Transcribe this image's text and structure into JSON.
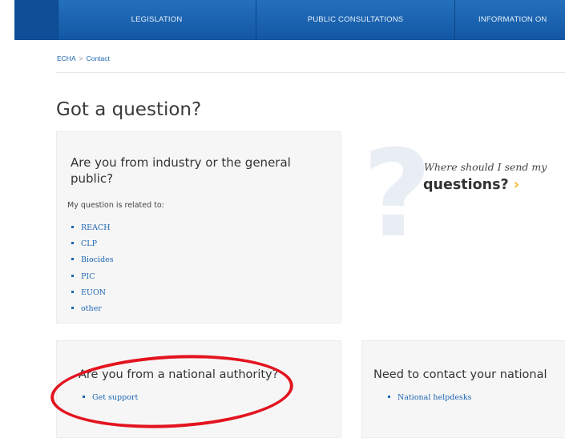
{
  "nav": {
    "items": [
      "LEGISLATION",
      "PUBLIC CONSULTATIONS",
      "INFORMATION ON"
    ]
  },
  "breadcrumb": {
    "home": "ECHA",
    "separator": ">",
    "current": "Contact"
  },
  "page_title": "Got a question?",
  "industry_card": {
    "heading": "Are you from industry or the general public?",
    "subtitle": "My question is related to:",
    "links": [
      "REACH",
      "CLP",
      "Biocides",
      "PIC",
      "EUON",
      "other"
    ]
  },
  "promo": {
    "question_text": "Where should I send my",
    "link_text": "questions?",
    "chevron": "›"
  },
  "authority_card": {
    "heading": "Are you from a national authority?",
    "links": [
      "Get support"
    ]
  },
  "national_card": {
    "heading": "Need to contact your national",
    "links": [
      "National helpdesks"
    ]
  },
  "colors": {
    "nav": "#1a5fa8",
    "link": "#1c66b3",
    "accent": "#f2b51c",
    "annotation": "#e3141f"
  }
}
